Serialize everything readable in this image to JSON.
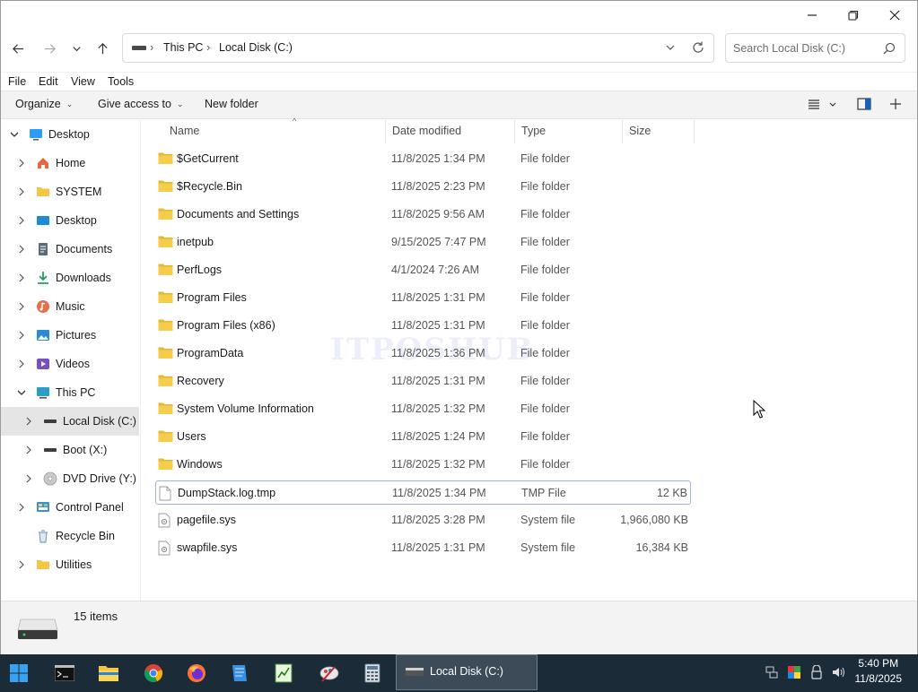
{
  "window": {
    "controls": {
      "minimize": "minimize",
      "maximize": "restore",
      "close": "close"
    }
  },
  "address": {
    "crumbs": [
      "This PC",
      "Local Disk (C:)"
    ],
    "search_placeholder": "Search Local Disk (C:)"
  },
  "menu": [
    "File",
    "Edit",
    "View",
    "Tools"
  ],
  "commands": {
    "organize": "Organize",
    "give_access": "Give access to",
    "new_folder": "New folder"
  },
  "nav": [
    {
      "label": "Desktop",
      "expanded": true,
      "level": 0,
      "icon": "desktop-icon"
    },
    {
      "label": "Home",
      "level": 1,
      "icon": "home-icon"
    },
    {
      "label": "SYSTEM",
      "level": 1,
      "icon": "folder-icon"
    },
    {
      "label": "Desktop",
      "level": 1,
      "icon": "desktop-icon"
    },
    {
      "label": "Documents",
      "level": 1,
      "icon": "documents-icon"
    },
    {
      "label": "Downloads",
      "level": 1,
      "icon": "downloads-icon"
    },
    {
      "label": "Music",
      "level": 1,
      "icon": "music-icon"
    },
    {
      "label": "Pictures",
      "level": 1,
      "icon": "pictures-icon"
    },
    {
      "label": "Videos",
      "level": 1,
      "icon": "videos-icon"
    },
    {
      "label": "This PC",
      "level": 1,
      "expanded": true,
      "icon": "this-pc-icon"
    },
    {
      "label": "Local Disk (C:)",
      "level": 2,
      "selected": true,
      "icon": "drive-icon"
    },
    {
      "label": "Boot (X:)",
      "level": 2,
      "icon": "drive-icon"
    },
    {
      "label": "DVD Drive (Y:) H",
      "level": 2,
      "icon": "dvd-icon"
    },
    {
      "label": "Control Panel",
      "level": 1,
      "icon": "control-panel-icon"
    },
    {
      "label": "Recycle Bin",
      "level": 1,
      "icon": "recycle-bin-icon"
    },
    {
      "label": "Utilities",
      "level": 1,
      "icon": "folder-icon"
    }
  ],
  "columns": {
    "name": "Name",
    "date": "Date modified",
    "type": "Type",
    "size": "Size"
  },
  "files": [
    {
      "name": "$GetCurrent",
      "date": "11/8/2025 1:34 PM",
      "type": "File folder",
      "size": "",
      "kind": "folder"
    },
    {
      "name": "$Recycle.Bin",
      "date": "11/8/2025 2:23 PM",
      "type": "File folder",
      "size": "",
      "kind": "folder"
    },
    {
      "name": "Documents and Settings",
      "date": "11/8/2025 9:56 AM",
      "type": "File folder",
      "size": "",
      "kind": "folder"
    },
    {
      "name": "inetpub",
      "date": "9/15/2025 7:47 PM",
      "type": "File folder",
      "size": "",
      "kind": "folder"
    },
    {
      "name": "PerfLogs",
      "date": "4/1/2024 7:26 AM",
      "type": "File folder",
      "size": "",
      "kind": "folder"
    },
    {
      "name": "Program Files",
      "date": "11/8/2025 1:31 PM",
      "type": "File folder",
      "size": "",
      "kind": "folder"
    },
    {
      "name": "Program Files (x86)",
      "date": "11/8/2025 1:31 PM",
      "type": "File folder",
      "size": "",
      "kind": "folder"
    },
    {
      "name": "ProgramData",
      "date": "11/8/2025 1:36 PM",
      "type": "File folder",
      "size": "",
      "kind": "folder"
    },
    {
      "name": "Recovery",
      "date": "11/8/2025 1:31 PM",
      "type": "File folder",
      "size": "",
      "kind": "folder"
    },
    {
      "name": "System Volume Information",
      "date": "11/8/2025 1:32 PM",
      "type": "File folder",
      "size": "",
      "kind": "folder"
    },
    {
      "name": "Users",
      "date": "11/8/2025 1:24 PM",
      "type": "File folder",
      "size": "",
      "kind": "folder"
    },
    {
      "name": "Windows",
      "date": "11/8/2025 1:32 PM",
      "type": "File folder",
      "size": "",
      "kind": "folder"
    },
    {
      "name": "DumpStack.log.tmp",
      "date": "11/8/2025 1:34 PM",
      "type": "TMP File",
      "size": "12 KB",
      "kind": "file",
      "focused": true
    },
    {
      "name": "pagefile.sys",
      "date": "11/8/2025 3:28 PM",
      "type": "System file",
      "size": "1,966,080 KB",
      "kind": "sysfile"
    },
    {
      "name": "swapfile.sys",
      "date": "11/8/2025 1:31 PM",
      "type": "System file",
      "size": "16,384 KB",
      "kind": "sysfile"
    }
  ],
  "watermark": "ITPOSHUB",
  "status": {
    "item_count": "15 items"
  },
  "taskbar": {
    "active_window": "Local Disk (C:)",
    "time": "5:40 PM",
    "date": "11/8/2025"
  },
  "colors": {
    "folder": "#f2c744",
    "taskbar": "#1c2b38",
    "accent": "#0078d4"
  }
}
